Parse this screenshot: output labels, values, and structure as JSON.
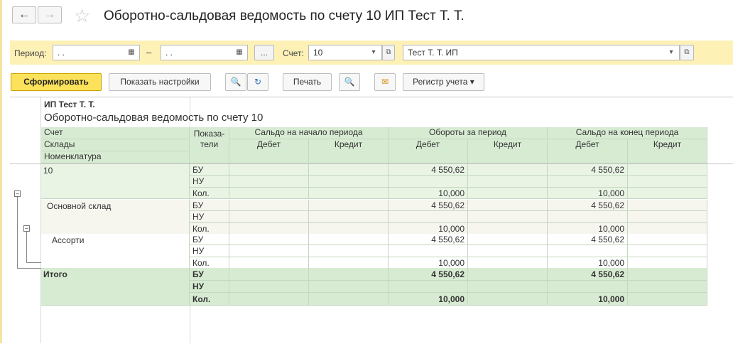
{
  "window": {
    "title": "Оборотно-сальдовая ведомость по счету 10 ИП Тест Т. Т.",
    "back_icon": "←",
    "forward_icon": "→",
    "star_icon": "☆"
  },
  "params": {
    "period_label": "Период:",
    "period_from": ". .",
    "period_to": ". .",
    "period_dash": "–",
    "period_pick_label": "...",
    "account_label": "Счет:",
    "account_value": "10",
    "org_value": "Тест Т. Т. ИП",
    "calendar_icon": "▦",
    "dropdown_icon": "▾",
    "open_icon": "⧉"
  },
  "toolbar": {
    "generate_label": "Сформировать",
    "settings_label": "Показать настройки",
    "search_icon": "🔍",
    "search_next_icon": "↻",
    "print_label": "Печать",
    "preview_icon": "🔍",
    "mail_icon": "✉",
    "register_label": "Регистр учета",
    "register_arrow": "▾"
  },
  "report": {
    "org": "ИП Тест Т. Т.",
    "title": "Оборотно-сальдовая ведомость по счету 10",
    "header": {
      "dimensions": [
        "Счет",
        "Склады",
        "Номенклатура"
      ],
      "indicators": "Показа-\nтели",
      "groups": [
        "Сальдо на начало периода",
        "Обороты за период",
        "Сальдо на конец периода"
      ],
      "debit": "Дебет",
      "credit": "Кредит"
    },
    "tree_toggle_icon": "–",
    "rows": [
      {
        "label": "10",
        "level": 0,
        "indicators": [
          "БУ",
          "НУ",
          "Кол."
        ],
        "turn_debit": [
          "4 550,62",
          "",
          "10,000"
        ],
        "end_debit": [
          "4 550,62",
          "",
          "10,000"
        ]
      },
      {
        "label": "Основной склад",
        "level": 1,
        "indicators": [
          "БУ",
          "НУ",
          "Кол."
        ],
        "turn_debit": [
          "4 550,62",
          "",
          "10,000"
        ],
        "end_debit": [
          "4 550,62",
          "",
          "10,000"
        ]
      },
      {
        "label": "Ассорти",
        "level": 2,
        "indicators": [
          "БУ",
          "НУ",
          "Кол."
        ],
        "turn_debit": [
          "4 550,62",
          "",
          "10,000"
        ],
        "end_debit": [
          "4 550,62",
          "",
          "10,000"
        ]
      }
    ],
    "total": {
      "label": "Итого",
      "indicators": [
        "БУ",
        "НУ",
        "Кол."
      ],
      "turn_debit": [
        "4 550,62",
        "",
        "10,000"
      ],
      "end_debit": [
        "4 550,62",
        "",
        "10,000"
      ]
    }
  }
}
